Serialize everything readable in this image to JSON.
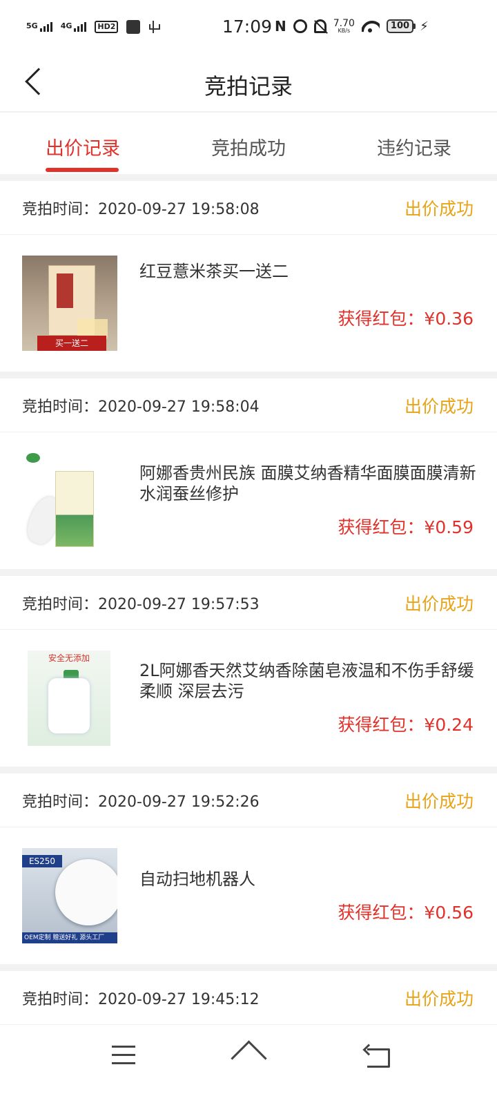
{
  "status_bar": {
    "sim1": "5G",
    "sim2": "4G",
    "hd": "HD2",
    "time": "17:09",
    "nfc": "N",
    "speed_value": "7.70",
    "speed_unit": "KB/s",
    "battery": "100"
  },
  "header": {
    "title": "竞拍记录"
  },
  "tabs": [
    {
      "label": "出价记录",
      "active": true
    },
    {
      "label": "竞拍成功",
      "active": false
    },
    {
      "label": "违约记录",
      "active": false
    }
  ],
  "records": [
    {
      "time_label": "竞拍时间：",
      "time": "2020-09-27 19:58:08",
      "status": "出价成功",
      "name": "红豆薏米茶买一送二",
      "prize_label": "获得红包：",
      "prize": "¥0.36",
      "image_text": "买一送二"
    },
    {
      "time_label": "竞拍时间：",
      "time": "2020-09-27 19:58:04",
      "status": "出价成功",
      "name": "阿娜香贵州民族 面膜艾纳香精华面膜面膜清新水润蚕丝修护",
      "prize_label": "获得红包：",
      "prize": "¥0.59"
    },
    {
      "time_label": "竞拍时间：",
      "time": "2020-09-27 19:57:53",
      "status": "出价成功",
      "name": "2L阿娜香天然艾纳香除菌皂液温和不伤手舒缓柔顺 深层去污",
      "prize_label": "获得红包：",
      "prize": "¥0.24",
      "image_text": "安全无添加"
    },
    {
      "time_label": "竞拍时间：",
      "time": "2020-09-27 19:52:26",
      "status": "出价成功",
      "name": "自动扫地机器人",
      "prize_label": "获得红包：",
      "prize": "¥0.56",
      "image_text": "ES250",
      "image_footer": "OEM定制 赠送好礼 源头工厂"
    },
    {
      "time_label": "竞拍时间：",
      "time": "2020-09-27 19:45:12",
      "status": "出价成功"
    }
  ],
  "colors": {
    "accent": "#e0312a",
    "status": "#e8a317"
  },
  "icons": {
    "back": "back-arrow-icon",
    "menu": "menu-icon",
    "home": "home-icon",
    "return": "return-icon"
  }
}
